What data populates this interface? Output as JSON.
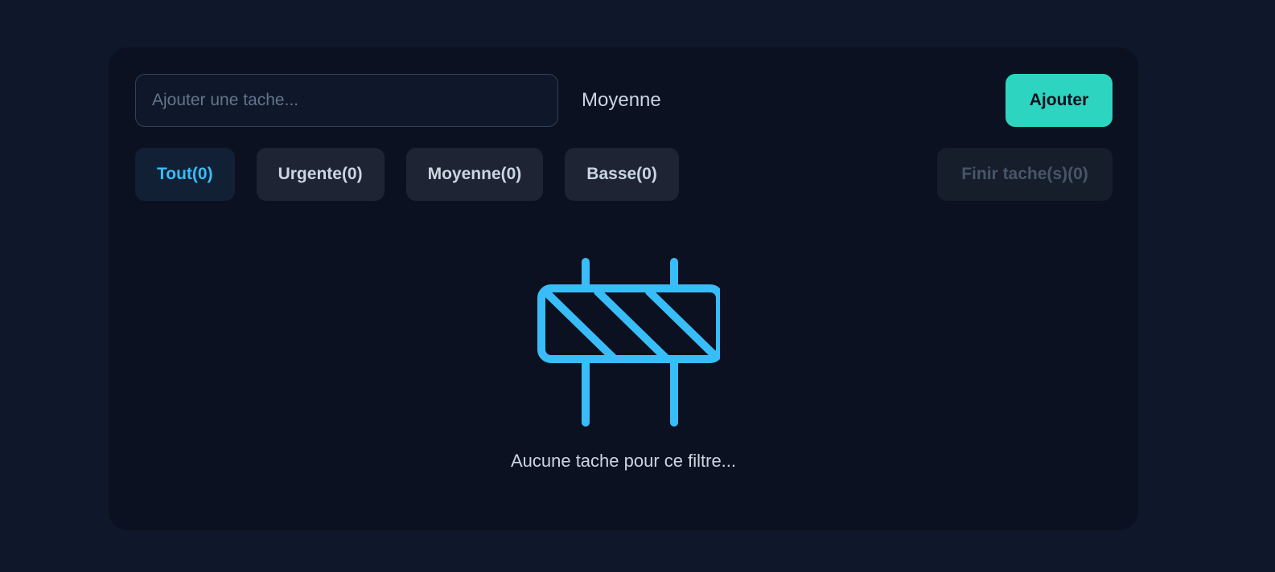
{
  "toolbar": {
    "task_placeholder": "Ajouter une tache...",
    "task_value": "",
    "priority_selected": "Moyenne",
    "add_label": "Ajouter"
  },
  "filters": {
    "items": [
      {
        "label": "Tout(0)",
        "active": true
      },
      {
        "label": "Urgente(0)",
        "active": false
      },
      {
        "label": "Moyenne(0)",
        "active": false
      },
      {
        "label": "Basse(0)",
        "active": false
      }
    ],
    "finish_label": "Finir tache(s)(0)"
  },
  "empty": {
    "icon": "road-barrier-icon",
    "message": "Aucune tache pour ce filtre..."
  },
  "colors": {
    "page_bg": "#0f172a",
    "card_bg": "#0b1120",
    "accent": "#2dd4bf",
    "active_filter": "#38bdf8",
    "icon": "#38bdf8"
  }
}
